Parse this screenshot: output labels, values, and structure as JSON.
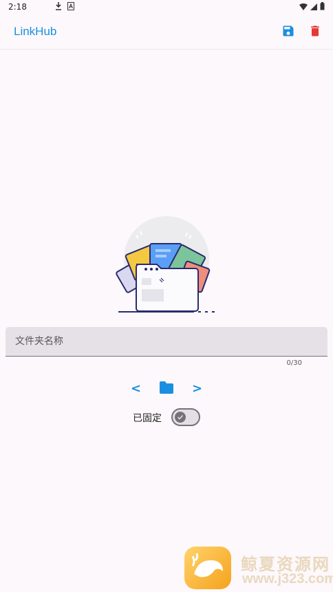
{
  "status_bar": {
    "time": "2:18",
    "icons": [
      "download-icon",
      "a-icon",
      "wifi-icon",
      "signal-icon",
      "battery-icon"
    ]
  },
  "app_bar": {
    "title": "LinkHub",
    "actions": [
      {
        "name": "save",
        "icon": "save-icon",
        "color": "#1a8fe0"
      },
      {
        "name": "delete",
        "icon": "trash-icon",
        "color": "#e53935"
      }
    ]
  },
  "illustration": {
    "icon": "folder-illustration"
  },
  "folder_name_field": {
    "placeholder": "文件夹名称",
    "value": "",
    "counter": "0/30"
  },
  "navigator": {
    "prev_label": "<",
    "next_label": ">",
    "folder_icon": "folder-icon",
    "accent": "#1a8fe0"
  },
  "pin": {
    "label": "已固定",
    "enabled": false
  },
  "watermark": {
    "text": "鲸夏资源网",
    "url": "www.j323.com"
  }
}
